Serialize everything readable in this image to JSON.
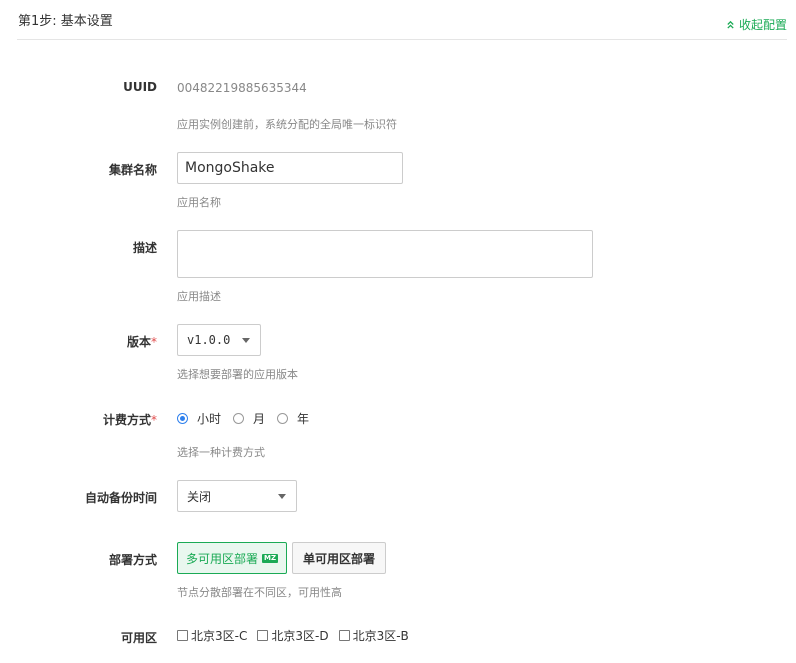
{
  "header": {
    "step_title": "第1步: 基本设置",
    "collapse_label": "收起配置"
  },
  "uuid": {
    "label": "UUID",
    "value": "00482219885635344",
    "help": "应用实例创建前，系统分配的全局唯一标识符"
  },
  "cluster_name": {
    "label": "集群名称",
    "value": "MongoShake",
    "help": "应用名称"
  },
  "description": {
    "label": "描述",
    "value": "",
    "help": "应用描述"
  },
  "version": {
    "label": "版本",
    "required_mark": "*",
    "selected": "v1.0.0",
    "help": "选择想要部署的应用版本"
  },
  "billing": {
    "label": "计费方式",
    "required_mark": "*",
    "options": [
      {
        "label": "小时",
        "checked": true
      },
      {
        "label": "月",
        "checked": false
      },
      {
        "label": "年",
        "checked": false
      }
    ],
    "help": "选择一种计费方式"
  },
  "auto_backup": {
    "label": "自动备份时间",
    "selected": "关闭"
  },
  "deploy": {
    "label": "部署方式",
    "multi_zone": "多可用区部署",
    "multi_zone_badge": "MZ",
    "single_zone": "单可用区部署",
    "help": "节点分散部署在不同区，可用性高"
  },
  "zones": {
    "label": "可用区",
    "items": [
      {
        "label": "北京3区-C",
        "checked": false
      },
      {
        "label": "北京3区-D",
        "checked": false
      },
      {
        "label": "北京3区-B",
        "checked": false
      }
    ]
  },
  "colors": {
    "accent_green": "#1aaa55",
    "radio_blue": "#2f80ed",
    "required_red": "#e14b4b"
  }
}
